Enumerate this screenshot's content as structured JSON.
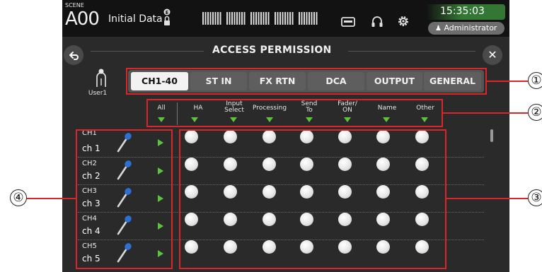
{
  "header": {
    "scene_label": "SCENE",
    "scene_number": "A00",
    "scene_name": "Initial Data",
    "time": "15:35:03",
    "user_role": "Administrator"
  },
  "dialog": {
    "title": "ACCESS PERMISSION",
    "user_name": "User1"
  },
  "tabs": [
    {
      "label": "CH1-40",
      "active": true
    },
    {
      "label": "ST IN",
      "active": false
    },
    {
      "label": "FX RTN",
      "active": false
    },
    {
      "label": "DCA",
      "active": false
    },
    {
      "label": "OUTPUT",
      "active": false
    },
    {
      "label": "GENERAL",
      "active": false
    }
  ],
  "columns": [
    {
      "line1": "All",
      "line2": ""
    },
    {
      "line1": "HA",
      "line2": ""
    },
    {
      "line1": "Input",
      "line2": "Select"
    },
    {
      "line1": "Processing",
      "line2": ""
    },
    {
      "line1": "Send",
      "line2": "To"
    },
    {
      "line1": "Fader/",
      "line2": "ON"
    },
    {
      "line1": "Name",
      "line2": ""
    },
    {
      "line1": "Other",
      "line2": ""
    }
  ],
  "channels": [
    {
      "id": "CH1",
      "name": "ch 1"
    },
    {
      "id": "CH2",
      "name": "ch 2"
    },
    {
      "id": "CH3",
      "name": "ch 3"
    },
    {
      "id": "CH4",
      "name": "ch 4"
    },
    {
      "id": "CH5",
      "name": "ch 5"
    }
  ],
  "callouts": {
    "c1": "①",
    "c2": "②",
    "c3": "③",
    "c4": "④"
  },
  "colors": {
    "accent_green": "#5cc43a",
    "annotation_red": "#d9262b"
  }
}
